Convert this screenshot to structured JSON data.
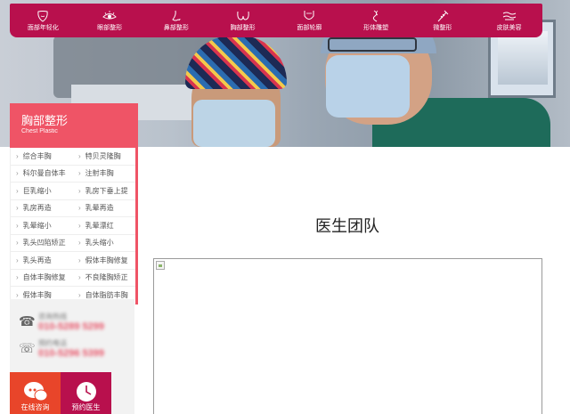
{
  "nav": {
    "items": [
      {
        "label": "面部年轻化",
        "icon": "face-icon"
      },
      {
        "label": "眼部整形",
        "icon": "eye-icon"
      },
      {
        "label": "鼻部整形",
        "icon": "nose-icon"
      },
      {
        "label": "胸部整形",
        "icon": "breast-icon"
      },
      {
        "label": "面部轮廓",
        "icon": "face-contour-icon"
      },
      {
        "label": "形体雕塑",
        "icon": "body-sculpt-icon"
      },
      {
        "label": "微整形",
        "icon": "syringe-icon"
      },
      {
        "label": "皮肤美容",
        "icon": "skin-icon"
      }
    ],
    "bg_color": "#b8104d"
  },
  "sidebar": {
    "title": "胸部整形",
    "subtitle": "Chest Plastic",
    "accent": "#ef5466",
    "links": [
      "综合丰胸",
      "特贝灵隆胸",
      "科尔曼自体丰",
      "注射丰胸",
      "巨乳缩小",
      "乳房下垂上提",
      "乳房再造",
      "乳晕再造",
      "乳晕缩小",
      "乳晕漂红",
      "乳头凹陷矫正",
      "乳头缩小",
      "乳头再造",
      "假体丰胸修复",
      "自体丰胸修复",
      "不良隆胸矫正",
      "假体丰胸",
      "自体脂肪丰胸"
    ]
  },
  "contact": {
    "hotline_label": "咨询热线",
    "hotline_number": "010-5289 5299",
    "phone_label": "预约电话",
    "phone_number": "010-5296 5399"
  },
  "buttons": {
    "chat": "在线咨询",
    "book": "预约医生"
  },
  "main": {
    "title": "医生团队"
  }
}
